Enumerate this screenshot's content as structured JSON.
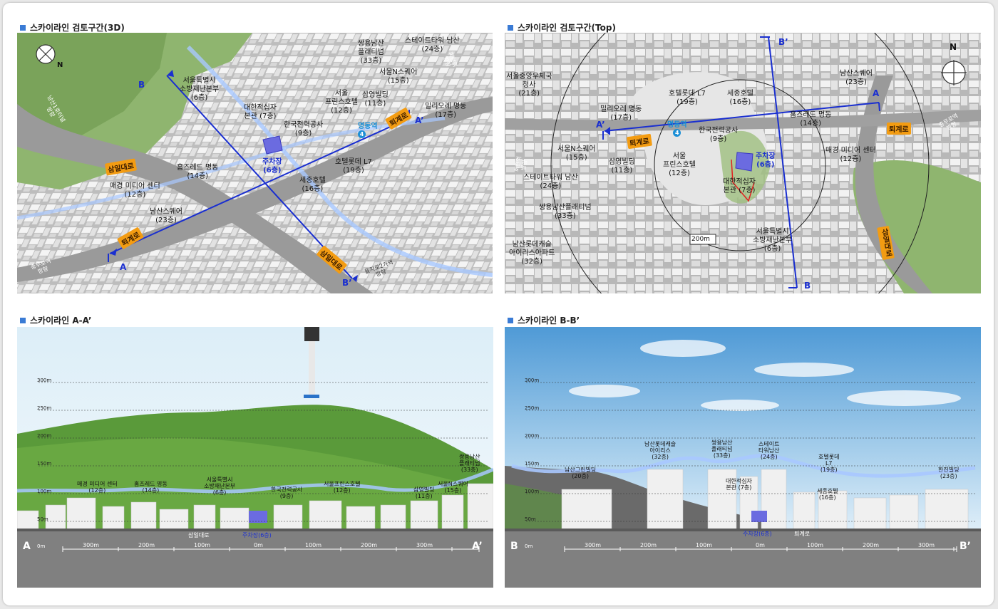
{
  "panels": {
    "p3d": {
      "title": "스카이라인 검토구간(3D)",
      "labels": [
        "서울특별시\n소방재난본부\n(6층)",
        "대한적십자\n본관 (7층)",
        "쌍용남산\n플래티넘\n(33층)",
        "스테이트타워 남산\n(24층)",
        "서울N스퀘어\n(15층)",
        "서울\n프린스호텔\n(12층)",
        "삼영빌딩\n(11층)",
        "밀리오레 명동\n(17층)",
        "한국전력공사\n(9층)",
        "호텔롯데 L7\n(19층)",
        "세종호텔\n(16층)",
        "홈즈레드 명동\n(14층)",
        "매경 미디어 센터\n(12층)",
        "남산스퀘어\n(23층)"
      ],
      "parking": "주차장\n(6층)",
      "station": "명동역",
      "station_no": "4",
      "roads": [
        "삼일대로",
        "퇴계로",
        "삼일대로",
        "퇴계로"
      ],
      "directions": [
        "남산1호터널\n방향",
        "충무로역\n방향",
        "을지로2가역\n방향",
        "회현역\n방향"
      ],
      "points": [
        "A",
        "A’",
        "B",
        "B’"
      ],
      "compass": "N"
    },
    "ptop": {
      "title": "스카이라인 검토구간(Top)",
      "labels": [
        "서울중앙우체국\n청사\n(21층)",
        "밀리오레 명동\n(17층)",
        "호텔롯데 L7\n(19층)",
        "세종호텔\n(16층)",
        "남산스퀘어\n(23층)",
        "홈즈레드 명동\n(14층)",
        "한국전력공사\n(9층)",
        "서울N스퀘어\n(15층)",
        "삼영빌딩\n(11층)",
        "서울\n프린스호텔\n(12층)",
        "매경 미디어 센터\n(12층)",
        "스테이트타워 남산\n(24층)",
        "대한적십자\n본관 (7층)",
        "쌍용남산플래티넘\n(33층)",
        "서울특별시\n소방재난본부\n(6층)",
        "남산롯데캐슬\n아이리스아파트\n(32층)"
      ],
      "parking": "주차장\n(6층)",
      "station": "명동역",
      "station_no": "4",
      "roads": [
        "퇴계로",
        "퇴계로",
        "삼일대로"
      ],
      "directions": [
        "충무로역\n방향",
        "회현역\n방향"
      ],
      "radius": "200m",
      "points": [
        "A",
        "A’",
        "B",
        "B’"
      ],
      "compass": "N"
    },
    "paa": {
      "title": "스카이라인 A-A’",
      "labels": [
        "매경 미디어 센터\n(12층)",
        "홈즈레드 명동\n(14층)",
        "서울특별시\n소방재난본부\n(6층)",
        "한국전력공사\n(9층)",
        "서울프린스호텔\n(12층)",
        "삼영빌딩\n(11층)",
        "서울N스퀘어\n(15층)",
        "쌍용남산\n플래티넘\n(33층)"
      ],
      "road": "삼일대로",
      "parking": "주차장(6층)",
      "heights": [
        "300m",
        "250m",
        "200m",
        "150m",
        "100m",
        "50m",
        "0m"
      ],
      "scale": [
        "300m",
        "200m",
        "100m",
        "0m",
        "100m",
        "200m",
        "300m"
      ],
      "ends": [
        "A",
        "A’"
      ]
    },
    "pbb": {
      "title": "스카이라인 B-B’",
      "labels": [
        "남산그린빌딩\n(20층)",
        "남산롯데캐슬\n아이리스\n(32층)",
        "쌍용남산\n플래티넘\n(33층)",
        "스테이트\n타워남산\n(24층)",
        "대한적십자\n본관 (7층)",
        "호텔롯데\nL7\n(19층)",
        "세종호텔\n(16층)",
        "한진빌딩\n(23층)"
      ],
      "road": "퇴계로",
      "parking": "주차장(6층)",
      "heights": [
        "300m",
        "250m",
        "200m",
        "150m",
        "100m",
        "50m",
        "0m"
      ],
      "scale": [
        "300m",
        "200m",
        "100m",
        "0m",
        "100m",
        "200m",
        "300m"
      ],
      "ends": [
        "B",
        "B’"
      ]
    }
  }
}
